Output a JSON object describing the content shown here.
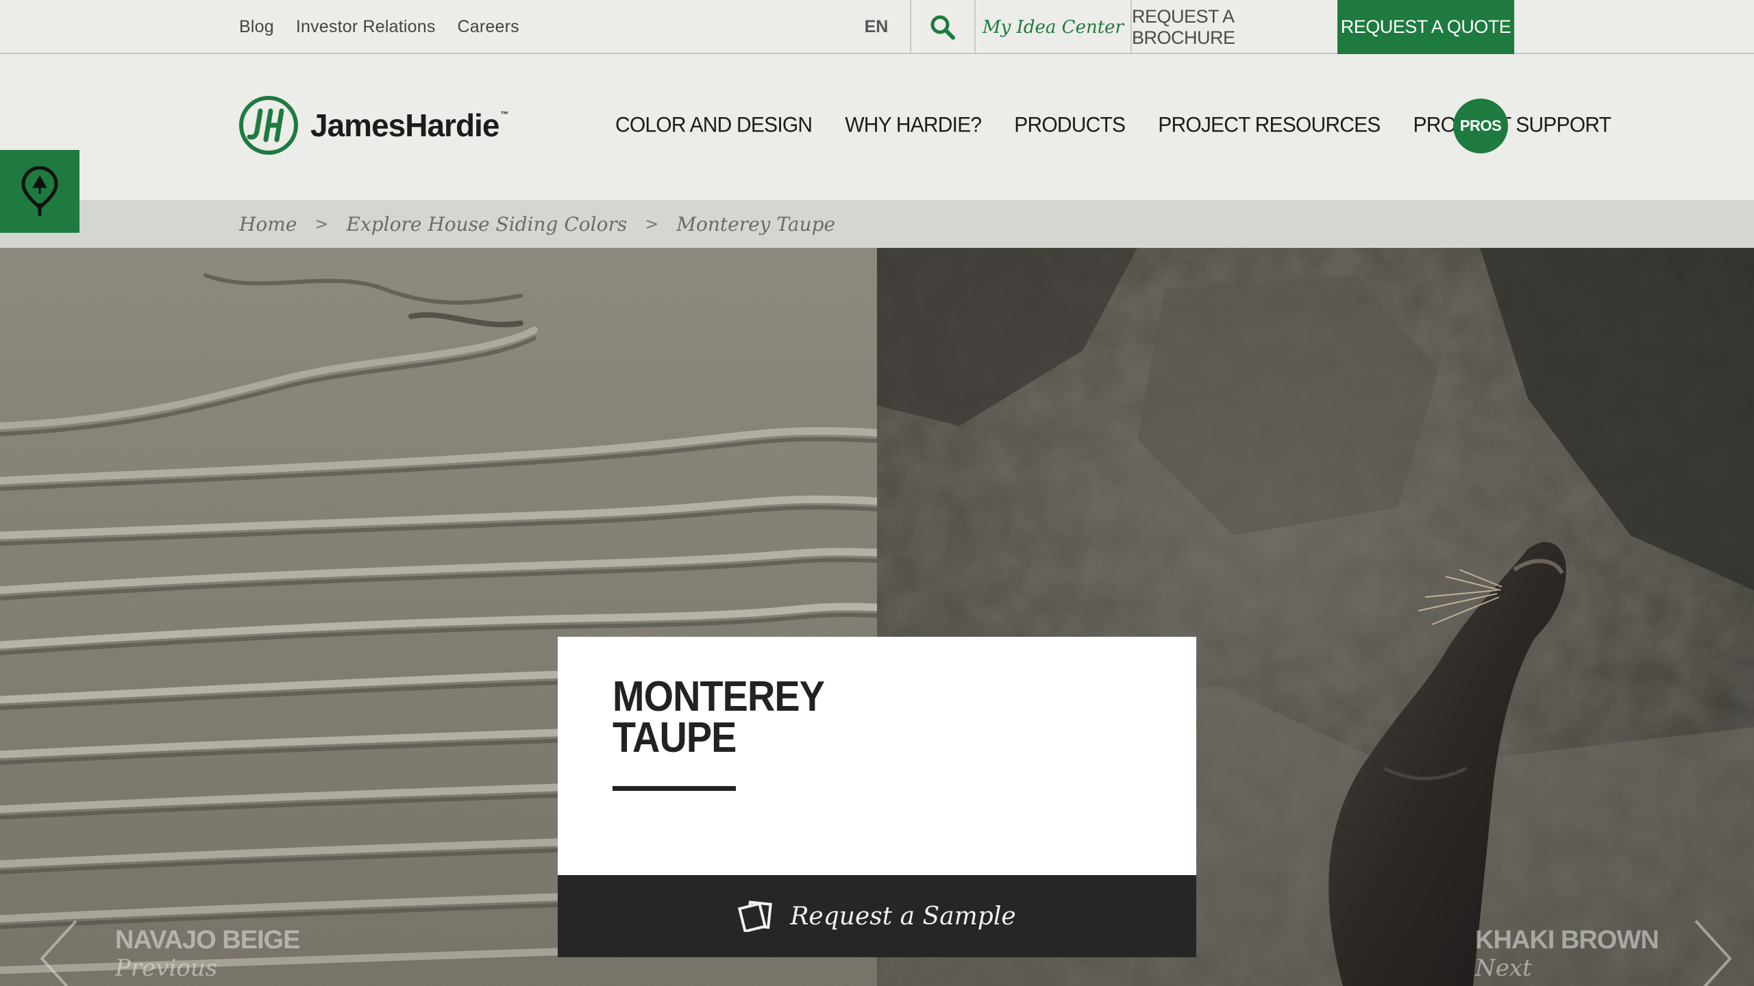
{
  "utility": {
    "links": [
      "Blog",
      "Investor Relations",
      "Careers"
    ],
    "language": "EN",
    "idea_center": "My Idea Center",
    "brochure": "REQUEST A BROCHURE",
    "quote": "REQUEST A QUOTE",
    "search_icon": "search-icon"
  },
  "brand": {
    "name": "JamesHardie",
    "trademark": "™",
    "accent": "#1e7a3f"
  },
  "nav": {
    "items": [
      "COLOR AND DESIGN",
      "WHY HARDIE?",
      "PRODUCTS",
      "PROJECT RESOURCES",
      "PRODUCT SUPPORT"
    ],
    "pros": "PROS"
  },
  "locator": {
    "icon": "map-pin-icon"
  },
  "breadcrumb": {
    "items": [
      "Home",
      "Explore House Siding Colors",
      "Monterey Taupe"
    ],
    "separator": ">"
  },
  "color": {
    "name_line1": "MONTEREY",
    "name_line2": "TAUPE",
    "sample_cta": "Request a Sample",
    "sample_icon": "swatch-cards-icon"
  },
  "pager": {
    "prev_name": "NAVAJO BEIGE",
    "prev_label": "Previous",
    "next_name": "KHAKI BROWN",
    "next_label": "Next"
  }
}
